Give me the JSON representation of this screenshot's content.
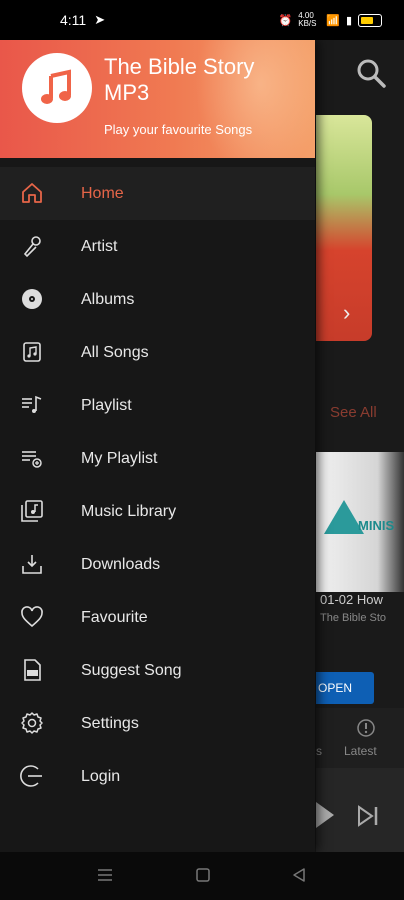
{
  "status_bar": {
    "time": "4:11",
    "network_speed": "4.00 KB/S"
  },
  "header": {
    "app_title": "The Bible Story MP3",
    "subtitle": "Play your favourite Songs"
  },
  "menu": [
    {
      "label": "Home",
      "icon": "home-icon",
      "active": true
    },
    {
      "label": "Artist",
      "icon": "artist-icon",
      "active": false
    },
    {
      "label": "Albums",
      "icon": "album-icon",
      "active": false
    },
    {
      "label": "All Songs",
      "icon": "all-songs-icon",
      "active": false
    },
    {
      "label": "Playlist",
      "icon": "playlist-icon",
      "active": false
    },
    {
      "label": "My Playlist",
      "icon": "my-playlist-icon",
      "active": false
    },
    {
      "label": "Music Library",
      "icon": "music-library-icon",
      "active": false
    },
    {
      "label": "Downloads",
      "icon": "download-icon",
      "active": false
    },
    {
      "label": "Favourite",
      "icon": "heart-icon",
      "active": false
    },
    {
      "label": "Suggest Song",
      "icon": "suggest-icon",
      "active": false
    },
    {
      "label": "Settings",
      "icon": "gear-icon",
      "active": false
    },
    {
      "label": "Login",
      "icon": "login-icon",
      "active": false
    }
  ],
  "background": {
    "see_all": "See All",
    "card_brand": "MINIS",
    "card_title": "01-02 How",
    "card_subtitle": "The Bible Sto",
    "open_button": "OPEN",
    "tab_partial": "s",
    "tab_latest": "Latest"
  },
  "colors": {
    "accent": "#e66548",
    "header_start": "#e9574a",
    "header_end": "#f4a06a",
    "drawer_bg": "#171717"
  }
}
